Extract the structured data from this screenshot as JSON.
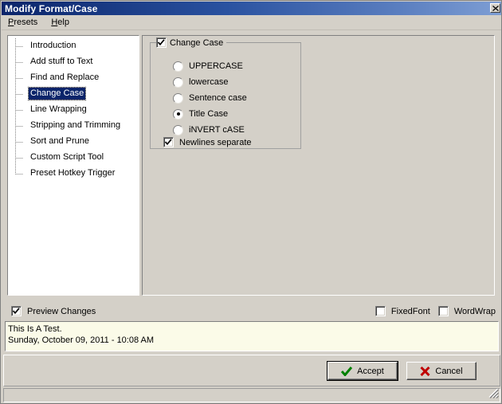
{
  "window": {
    "title": "Modify Format/Case",
    "close_icon": "close-x-icon"
  },
  "menubar": {
    "items": [
      {
        "label": "Presets",
        "accel": "P",
        "rest": "resets"
      },
      {
        "label": "Help",
        "accel": "H",
        "rest": "elp"
      }
    ]
  },
  "tree": {
    "items": [
      {
        "label": "Introduction",
        "selected": false
      },
      {
        "label": "Add stuff to Text",
        "selected": false
      },
      {
        "label": "Find and Replace",
        "selected": false
      },
      {
        "label": "Change Case",
        "selected": true
      },
      {
        "label": "Line Wrapping",
        "selected": false
      },
      {
        "label": "Stripping and Trimming",
        "selected": false
      },
      {
        "label": "Sort and Prune",
        "selected": false
      },
      {
        "label": "Custom Script Tool",
        "selected": false
      },
      {
        "label": "Preset Hotkey Trigger",
        "selected": false
      }
    ]
  },
  "groupbox": {
    "title": "Change Case",
    "title_checked": true,
    "options": [
      {
        "label": "UPPERCASE",
        "selected": false
      },
      {
        "label": "lowercase",
        "selected": false
      },
      {
        "label": "Sentence case",
        "selected": false
      },
      {
        "label": "Title Case",
        "selected": true
      },
      {
        "label": "iNVERT cASE",
        "selected": false
      }
    ],
    "newlines": {
      "label": "Newlines separate",
      "checked": true
    }
  },
  "options_bar": {
    "preview_changes": {
      "label": "Preview Changes",
      "checked": true
    },
    "fixed_font": {
      "label": "FixedFont",
      "checked": false
    },
    "word_wrap": {
      "label": "WordWrap",
      "checked": false
    }
  },
  "preview": {
    "line1": "This Is A Test.",
    "line2": "Sunday, October 09, 2011 - 10:08 AM"
  },
  "buttons": {
    "accept": {
      "label": "Accept",
      "icon": "green-check-icon"
    },
    "cancel": {
      "label": "Cancel",
      "icon": "red-x-icon"
    }
  },
  "colors": {
    "face": "#d4d0c8",
    "title_start": "#0a246a",
    "title_end": "#7e9ed4",
    "selection": "#0a246a",
    "preview_bg": "#fbfbe8",
    "accept_icon": "#008000",
    "cancel_icon": "#c00000"
  }
}
